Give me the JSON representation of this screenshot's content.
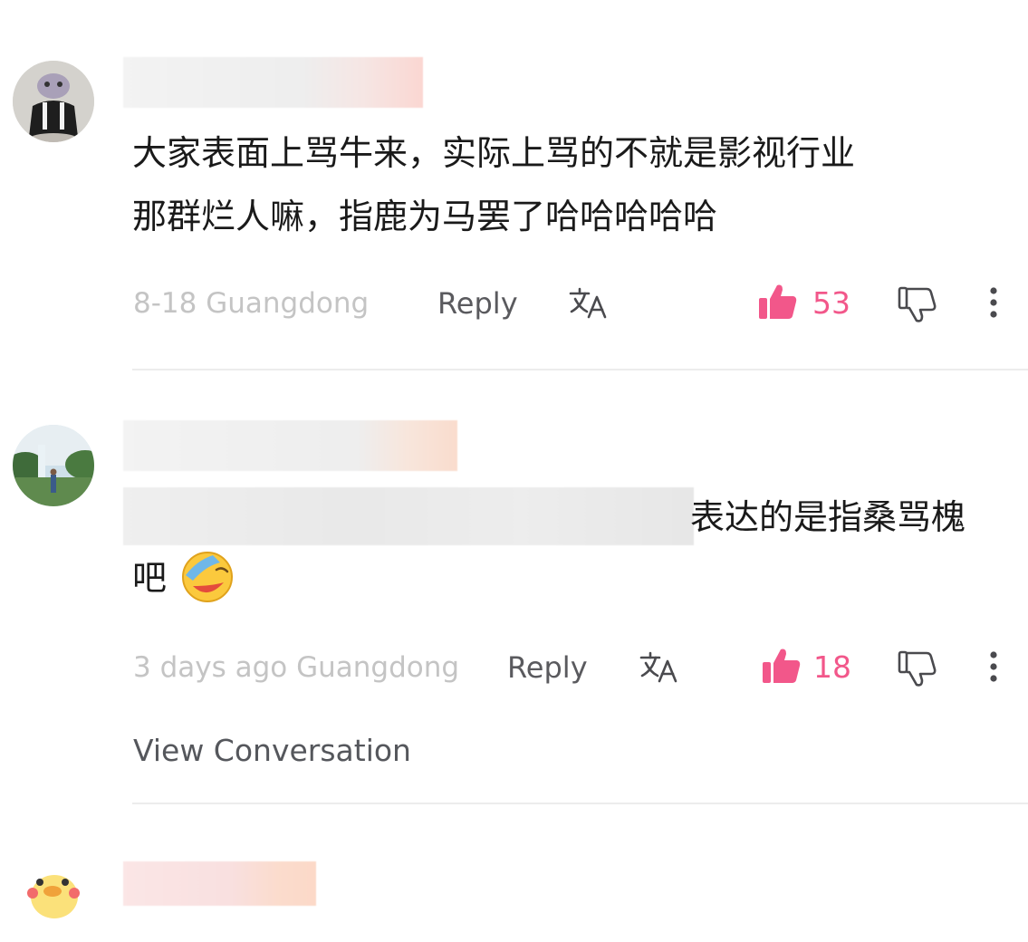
{
  "comments": [
    {
      "text_line1": "大家表面上骂牛来，实际上骂的不就是影视行业",
      "text_line2": "那群烂人嘛，指鹿为马罢了哈哈哈哈哈",
      "meta": "8-18 Guangdong",
      "reply_label": "Reply",
      "likes": "53"
    },
    {
      "text_line1_visible": "表达的是指桑骂槐",
      "text_line2": "吧",
      "emoji": "laughing-face-with-covered-eyes",
      "meta": "3 days ago Guangdong",
      "reply_label": "Reply",
      "likes": "18"
    }
  ],
  "view_conversation_label": "View Conversation",
  "colors": {
    "like_accent": "#f2578a",
    "meta_gray": "#c4c4c4",
    "text": "#1a1a1a",
    "divider": "#ececec"
  },
  "icons": {
    "translate": "translate-icon",
    "like": "thumbs-up-icon",
    "dislike": "thumbs-down-icon",
    "more": "more-vertical-icon"
  }
}
